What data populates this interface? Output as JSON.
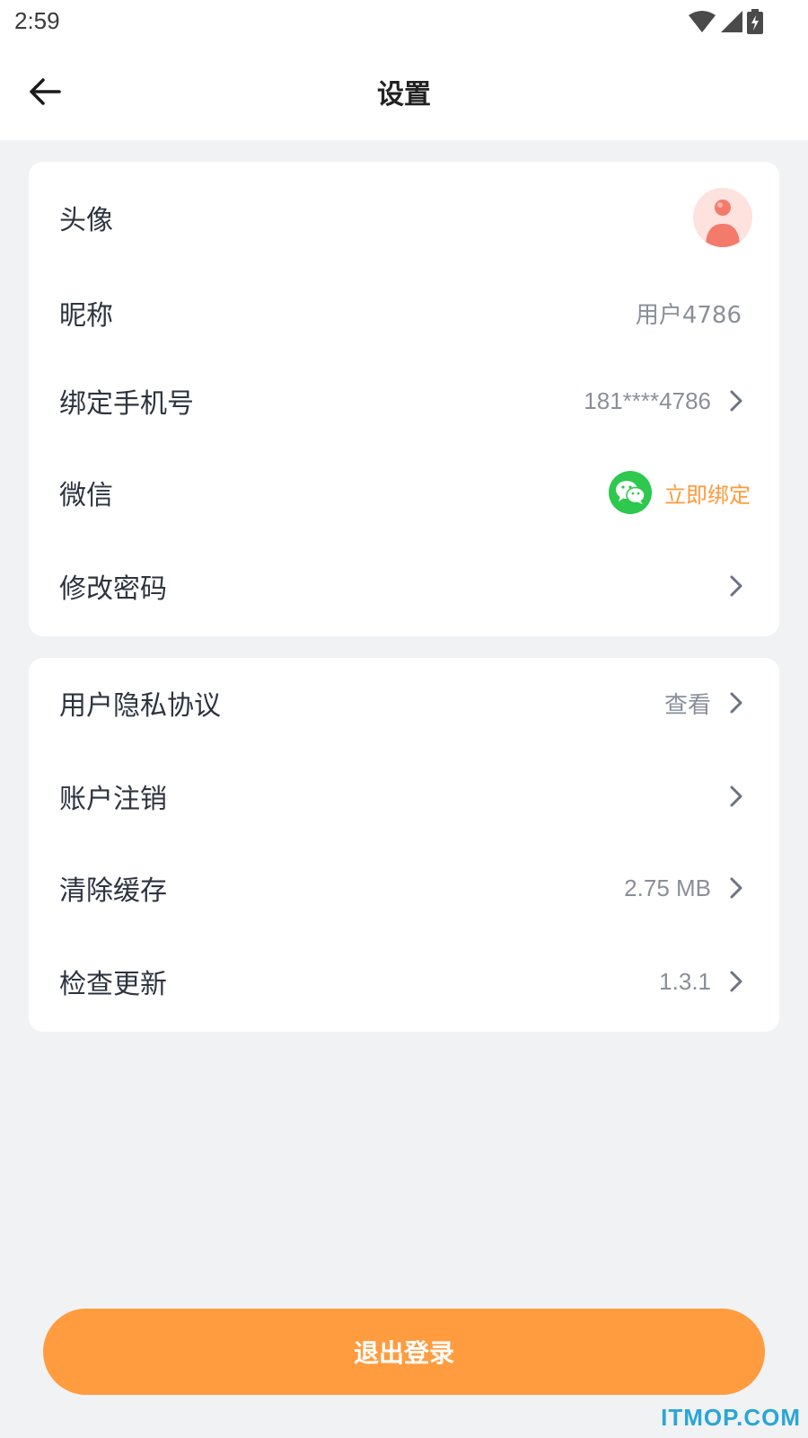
{
  "status_bar": {
    "time": "2:59",
    "icons": [
      "wifi-icon",
      "signal-icon",
      "battery-charging-icon"
    ]
  },
  "header": {
    "title": "设置",
    "back_icon": "arrow-left-icon"
  },
  "account_section": {
    "avatar_label": "头像",
    "nickname_label": "昵称",
    "nickname_value": "用户4786",
    "phone_label": "绑定手机号",
    "phone_value": "181****4786",
    "wechat_label": "微信",
    "wechat_action": "立即绑定",
    "password_label": "修改密码"
  },
  "settings_section": {
    "privacy_label": "用户隐私协议",
    "privacy_value": "查看",
    "deregister_label": "账户注销",
    "cache_label": "清除缓存",
    "cache_value": "2.75 MB",
    "update_label": "检查更新",
    "update_value": "1.3.1"
  },
  "logout_label": "退出登录",
  "watermark": "ITMOP.COM",
  "colors": {
    "accent": "#ff9c3f",
    "wechat_green": "#2dc84d",
    "background": "#f1f2f4"
  }
}
